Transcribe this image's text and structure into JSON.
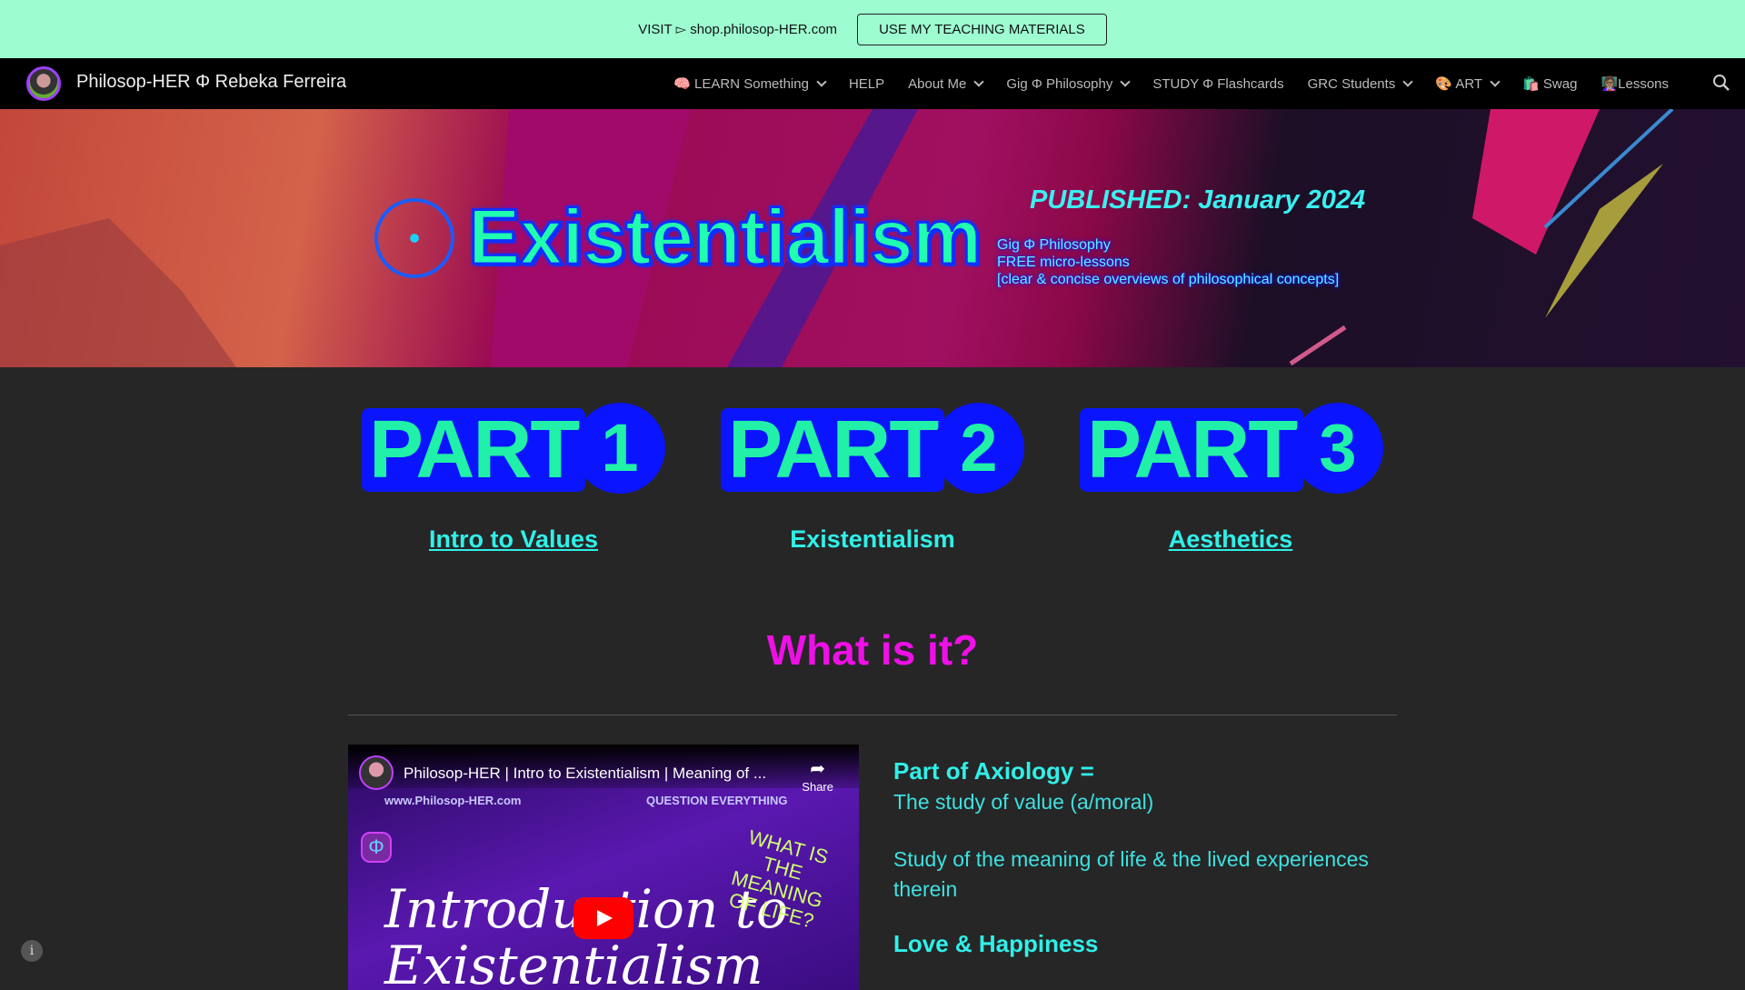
{
  "topbar": {
    "visit_text": "VISIT ▻ shop.philosop-HER.com",
    "button_label": "USE MY TEACHING MATERIALS",
    "background": "#9dfdd0"
  },
  "nav": {
    "site_title": "Philosop-HER Φ Rebeka Ferreira",
    "items": [
      {
        "label": "🧠 LEARN Something",
        "dropdown": true
      },
      {
        "label": "HELP",
        "dropdown": false
      },
      {
        "label": "About Me",
        "dropdown": true
      },
      {
        "label": "Gig Φ Philosophy",
        "dropdown": true
      },
      {
        "label": "STUDY Φ Flashcards",
        "dropdown": false
      },
      {
        "label": "GRC Students",
        "dropdown": true
      },
      {
        "label": "🎨 ART",
        "dropdown": true
      },
      {
        "label": "🛍️ Swag",
        "dropdown": false
      },
      {
        "label": "👩🏽‍🏫Lessons",
        "dropdown": false
      }
    ],
    "search_icon": "search-icon"
  },
  "banner": {
    "title": "Existentialism",
    "published": "PUBLISHED: January 2024",
    "lines": [
      "Gig Φ Philosophy",
      "FREE micro-lessons",
      "[clear & concise overviews of philosophical concepts]"
    ]
  },
  "parts": [
    {
      "word": "PART",
      "number": "1",
      "link": "Intro to Values",
      "linked": true
    },
    {
      "word": "PART",
      "number": "2",
      "link": "Existentialism",
      "linked": false
    },
    {
      "word": "PART",
      "number": "3",
      "link": "Aesthetics",
      "linked": true
    }
  ],
  "section_title": "What is it?",
  "video": {
    "title": "Philosop-HER | Intro to Existentialism | Meaning of ...",
    "share_label": "Share",
    "thumb_url_text": "www.Philosop-HER.com",
    "thumb_tagline": "QUESTION EVERYTHING",
    "thumb_title": "Introduction to Existentialism",
    "thumb_question": "WHAT IS THE MEANING OF LIFE?"
  },
  "content": {
    "heading1": "Part of Axiology =",
    "line1": "The study of value (a/moral)",
    "para": "Study of the meaning of life & the lived experiences therein",
    "heading2": "Love & Happiness"
  },
  "colors": {
    "accent_cyan": "#30f0e8",
    "magenta": "#ee10e6",
    "part_blue": "#0a14ff",
    "part_green": "#20f0a8"
  }
}
